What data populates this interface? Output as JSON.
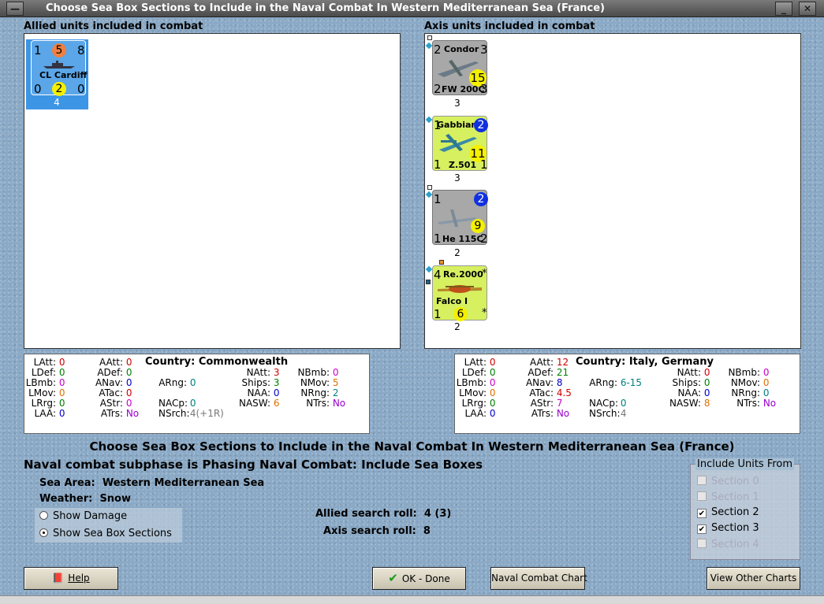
{
  "window": {
    "title": "Choose Sea Box Sections to Include in the Naval Combat In Western Mediterranean Sea (France)",
    "menu_glyph": "—",
    "minimize_glyph": "_",
    "close_glyph": "✕"
  },
  "allied": {
    "heading": "Allied units included in combat",
    "units": [
      {
        "name": "CL Cardiff",
        "tl": "1",
        "tc": "5",
        "tr": "8",
        "bl": "0",
        "bc": "2",
        "br": "0",
        "steps": "4",
        "selected": true,
        "color": "#4a9ae0"
      }
    ],
    "stats": {
      "latt_label": "LAtt:",
      "latt": "0",
      "ldef_label": "LDef:",
      "ldef": "0",
      "lbmb_label": "LBmb:",
      "lbmb": "0",
      "lmov_label": "LMov:",
      "lmov": "0",
      "lrrg_label": "LRrg:",
      "lrrg": "0",
      "laa_label": "LAA:",
      "laa": "0",
      "aatt_label": "AAtt:",
      "aatt": "0",
      "adef_label": "ADef:",
      "adef": "0",
      "anav_label": "ANav:",
      "anav": "0",
      "atac_label": "ATac:",
      "atac": "0",
      "astr_label": "AStr:",
      "astr": "0",
      "atrs_label": "ATrs:",
      "atrs": "No",
      "country_label": "Country:",
      "country": "Commonwealth",
      "arng_label": "ARng:",
      "arng": "0",
      "nacp_label": "NACp:",
      "nacp": "0",
      "natt_label": "NAtt:",
      "natt": "3",
      "ships_label": "Ships:",
      "ships": "3",
      "naa_label": "NAA:",
      "naa": "0",
      "nasw_label": "NASW:",
      "nasw": "6",
      "nsrch_label": "NSrch:",
      "nsrch": "4(+1R)",
      "nbmb_label": "NBmb:",
      "nbmb": "0",
      "nmov_label": "NMov:",
      "nmov": "5",
      "nrng_label": "NRng:",
      "nrng": "2",
      "ntrs_label": "NTrs:",
      "ntrs": "No"
    }
  },
  "axis": {
    "heading": "Axis units included in combat",
    "units": [
      {
        "name": "Condor",
        "type": "FW 200C",
        "tl": "2",
        "tr": "3",
        "bl": "2",
        "br": "3",
        "val": "15",
        "steps": "3",
        "color": "#a8a8a8"
      },
      {
        "name": "Gabbiano",
        "type": "Z.501",
        "tl": "1",
        "tr": "2",
        "bl": "1",
        "br": "1",
        "val": "11",
        "steps": "3",
        "color": "#d6f060"
      },
      {
        "name": "",
        "type": "He 115C",
        "tl": "1",
        "tr": "2",
        "bl": "1",
        "br": "2",
        "val": "9",
        "steps": "2",
        "color": "#a8a8a8"
      },
      {
        "name": "Re.2000",
        "type": "Falco I",
        "tl": "4",
        "tr": "*",
        "bl": "1",
        "br": "*",
        "val": "6",
        "steps": "2",
        "color": "#d6f060"
      }
    ],
    "stats": {
      "latt_label": "LAtt:",
      "latt": "0",
      "ldef_label": "LDef:",
      "ldef": "0",
      "lbmb_label": "LBmb:",
      "lbmb": "0",
      "lmov_label": "LMov:",
      "lmov": "0",
      "lrrg_label": "LRrg:",
      "lrrg": "0",
      "laa_label": "LAA:",
      "laa": "0",
      "aatt_label": "AAtt:",
      "aatt": "12",
      "adef_label": "ADef:",
      "adef": "21",
      "anav_label": "ANav:",
      "anav": "8",
      "atac_label": "ATac:",
      "atac": "4.5",
      "astr_label": "AStr:",
      "astr": "7",
      "atrs_label": "ATrs:",
      "atrs": "No",
      "country_label": "Country:",
      "country": "Italy, Germany",
      "arng_label": "ARng:",
      "arng": "6-15",
      "nacp_label": "NACp:",
      "nacp": "0",
      "natt_label": "NAtt:",
      "natt": "0",
      "ships_label": "Ships:",
      "ships": "0",
      "naa_label": "NAA:",
      "naa": "0",
      "nasw_label": "NASW:",
      "nasw": "8",
      "nsrch_label": "NSrch:",
      "nsrch": "4",
      "nbmb_label": "NBmb:",
      "nbmb": "0",
      "nmov_label": "NMov:",
      "nmov": "0",
      "nrng_label": "NRng:",
      "nrng": "0",
      "ntrs_label": "NTrs:",
      "ntrs": "No"
    }
  },
  "main": {
    "title": "Choose Sea Box Sections to Include in the Naval Combat In Western Mediterranean Sea (France)",
    "subphase": "Naval combat subphase is Phasing Naval Combat: Include Sea Boxes",
    "sea_area_label": "Sea Area:",
    "sea_area": "Western Mediterranean Sea",
    "weather_label": "Weather:",
    "weather": "Snow",
    "show_damage": "Show Damage",
    "show_sections": "Show Sea Box Sections",
    "allied_roll_label": "Allied search roll:",
    "allied_roll": "4 (3)",
    "axis_roll_label": "Axis search roll:",
    "axis_roll": "8"
  },
  "include": {
    "title": "Include Units From",
    "sections": [
      {
        "label": "Section 0",
        "checked": false,
        "enabled": false
      },
      {
        "label": "Section 1",
        "checked": false,
        "enabled": false
      },
      {
        "label": "Section 2",
        "checked": true,
        "enabled": true
      },
      {
        "label": "Section 3",
        "checked": true,
        "enabled": true
      },
      {
        "label": "Section 4",
        "checked": false,
        "enabled": false
      }
    ]
  },
  "buttons": {
    "help": "Help",
    "ok": "OK - Done",
    "naval_chart": "Naval Combat Chart",
    "other_charts": "View Other Charts"
  }
}
